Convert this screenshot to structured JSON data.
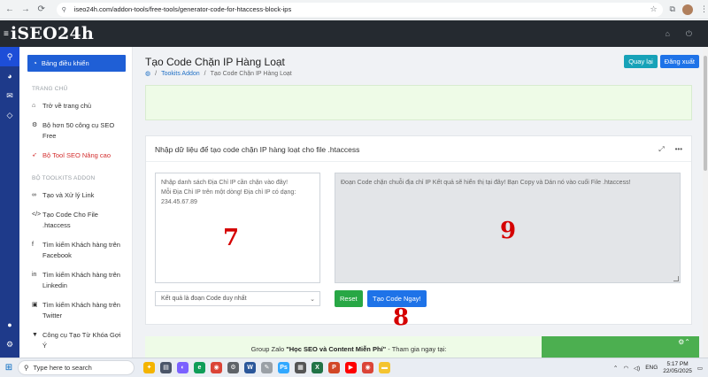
{
  "browser": {
    "url": "iseo24h.com/addon-tools/free-tools/generator-code-for-htaccess-block-ips",
    "back_icon": "←",
    "forward_icon": "→",
    "reload_icon": "⟳"
  },
  "header": {
    "logo": "iSEO24h"
  },
  "sidebar": {
    "dashboard": "Bảng điều khiển",
    "section_home": "TRANG CHỦ",
    "items_home": [
      {
        "label": "Trở về trang chủ"
      },
      {
        "label": "Bộ hơn 50 công cụ SEO Free"
      },
      {
        "label": "Bộ Tool SEO Nâng cao"
      }
    ],
    "section_toolkits": "BỘ TOOLKITS ADDON",
    "items_toolkits": [
      {
        "label": "Tạo và Xử lý Link"
      },
      {
        "label": "Tạo Code Cho File .htaccess"
      },
      {
        "label": "Tìm kiếm Khách hàng trên Facebook"
      },
      {
        "label": "Tìm kiếm Khách hàng trên Linkedin"
      },
      {
        "label": "Tìm kiếm Khách hàng trên Twitter"
      },
      {
        "label": "Công cụ Tạo Từ Khóa Gợi Ý"
      }
    ]
  },
  "main": {
    "title": "Tạo Code Chặn IP Hàng Loạt",
    "breadcrumb": {
      "link": "Tookits Addon",
      "current": "Tạo Code Chặn IP Hàng Loạt"
    },
    "back_button": "Quay lại",
    "logout_button": "Đăng xuất",
    "card_title": "Nhập dữ liệu để tạo code chặn IP hàng loạt cho file .htaccess",
    "input_placeholder": "Nhập danh sách Địa Chỉ IP cần chặn vào đây!\nMỗi Địa Chỉ IP trên một dòng! Địa chỉ IP có dạng: 234.45.67.89",
    "output_placeholder": "Đoạn Code chặn chuỗi địa chỉ IP Kết quả sẽ hiển thị tại đây! Bạn Copy và Dán nó vào cuối File .htaccess!",
    "select_value": "Kết quả là đoạn Code duy nhất",
    "reset_button": "Reset",
    "create_button": "Tạo Code Ngay!",
    "zalo_prefix": "Group Zalo ",
    "zalo_group": "\"Học SEO và Content Miễn Phí\"",
    "zalo_suffix": " - Tham gia ngay tại:"
  },
  "annotations": {
    "input": "7",
    "output": "9",
    "button": "8"
  },
  "taskbar": {
    "search_placeholder": "Type here to search",
    "language": "ENG",
    "time": "5:17 PM",
    "date": "22/05/2025"
  },
  "colors": {
    "header_bg": "#252a30",
    "rail_bg": "#1e3a8a",
    "primary": "#1e73e8",
    "success": "#28a745",
    "teal": "#17a2b8",
    "annotation": "#d50000"
  }
}
